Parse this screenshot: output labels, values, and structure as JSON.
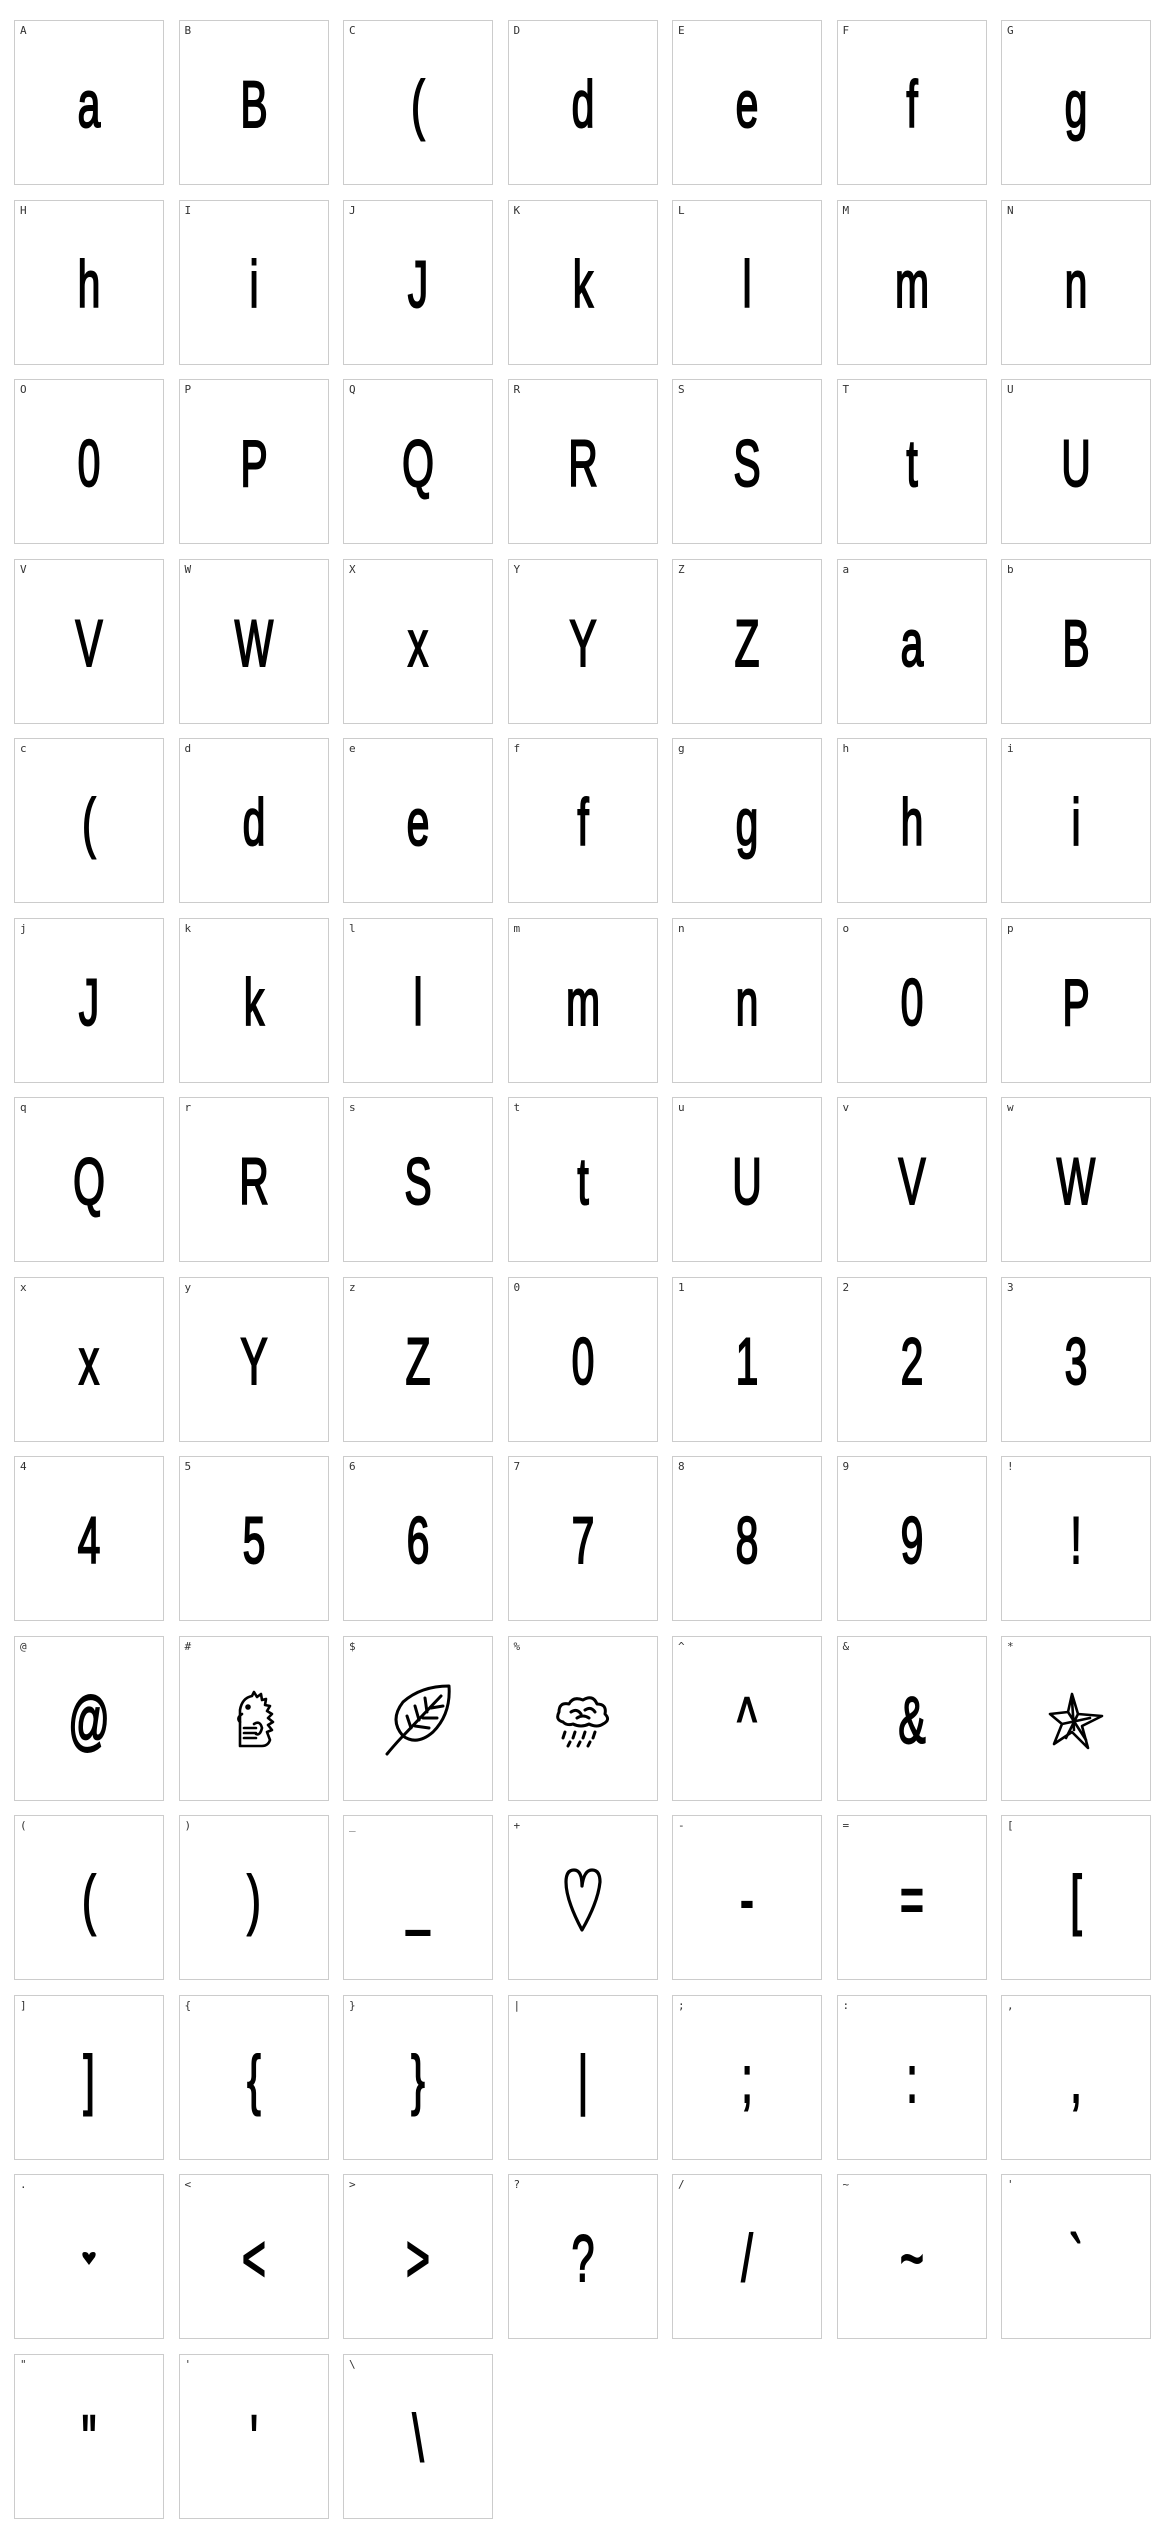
{
  "glyphs": [
    {
      "label": "A",
      "glyph": "a"
    },
    {
      "label": "B",
      "glyph": "B"
    },
    {
      "label": "C",
      "glyph": "("
    },
    {
      "label": "D",
      "glyph": "d"
    },
    {
      "label": "E",
      "glyph": "e"
    },
    {
      "label": "F",
      "glyph": "f"
    },
    {
      "label": "G",
      "glyph": "g"
    },
    {
      "label": "H",
      "glyph": "h"
    },
    {
      "label": "I",
      "glyph": "i"
    },
    {
      "label": "J",
      "glyph": "J"
    },
    {
      "label": "K",
      "glyph": "k"
    },
    {
      "label": "L",
      "glyph": "l"
    },
    {
      "label": "M",
      "glyph": "m"
    },
    {
      "label": "N",
      "glyph": "n"
    },
    {
      "label": "O",
      "glyph": "0"
    },
    {
      "label": "P",
      "glyph": "P"
    },
    {
      "label": "Q",
      "glyph": "Q"
    },
    {
      "label": "R",
      "glyph": "R"
    },
    {
      "label": "S",
      "glyph": "S"
    },
    {
      "label": "T",
      "glyph": "t"
    },
    {
      "label": "U",
      "glyph": "U"
    },
    {
      "label": "V",
      "glyph": "V"
    },
    {
      "label": "W",
      "glyph": "W"
    },
    {
      "label": "X",
      "glyph": "x"
    },
    {
      "label": "Y",
      "glyph": "Y"
    },
    {
      "label": "Z",
      "glyph": "Z"
    },
    {
      "label": "a",
      "glyph": "a"
    },
    {
      "label": "b",
      "glyph": "B"
    },
    {
      "label": "c",
      "glyph": "("
    },
    {
      "label": "d",
      "glyph": "d"
    },
    {
      "label": "e",
      "glyph": "e"
    },
    {
      "label": "f",
      "glyph": "f"
    },
    {
      "label": "g",
      "glyph": "g"
    },
    {
      "label": "h",
      "glyph": "h"
    },
    {
      "label": "i",
      "glyph": "i"
    },
    {
      "label": "j",
      "glyph": "J"
    },
    {
      "label": "k",
      "glyph": "k"
    },
    {
      "label": "l",
      "glyph": "l"
    },
    {
      "label": "m",
      "glyph": "m"
    },
    {
      "label": "n",
      "glyph": "n"
    },
    {
      "label": "o",
      "glyph": "0"
    },
    {
      "label": "p",
      "glyph": "P"
    },
    {
      "label": "q",
      "glyph": "Q"
    },
    {
      "label": "r",
      "glyph": "R"
    },
    {
      "label": "s",
      "glyph": "S"
    },
    {
      "label": "t",
      "glyph": "t"
    },
    {
      "label": "u",
      "glyph": "U"
    },
    {
      "label": "v",
      "glyph": "V"
    },
    {
      "label": "w",
      "glyph": "W"
    },
    {
      "label": "x",
      "glyph": "x"
    },
    {
      "label": "y",
      "glyph": "Y"
    },
    {
      "label": "z",
      "glyph": "Z"
    },
    {
      "label": "0",
      "glyph": "0"
    },
    {
      "label": "1",
      "glyph": "1"
    },
    {
      "label": "2",
      "glyph": "2"
    },
    {
      "label": "3",
      "glyph": "3"
    },
    {
      "label": "4",
      "glyph": "4"
    },
    {
      "label": "5",
      "glyph": "5"
    },
    {
      "label": "6",
      "glyph": "6"
    },
    {
      "label": "7",
      "glyph": "7"
    },
    {
      "label": "8",
      "glyph": "8"
    },
    {
      "label": "9",
      "glyph": "9"
    },
    {
      "label": "!",
      "glyph": "!"
    },
    {
      "label": "@",
      "glyph": "@"
    },
    {
      "label": "#",
      "glyph": "",
      "icon": "dinosaur-icon"
    },
    {
      "label": "$",
      "glyph": "",
      "icon": "leaf-icon"
    },
    {
      "label": "%",
      "glyph": "",
      "icon": "rain-cloud-icon"
    },
    {
      "label": "^",
      "glyph": "^"
    },
    {
      "label": "&",
      "glyph": "&"
    },
    {
      "label": "*",
      "glyph": "",
      "icon": "star-icon"
    },
    {
      "label": "(",
      "glyph": "("
    },
    {
      "label": ")",
      "glyph": ")"
    },
    {
      "label": "_",
      "glyph": "_"
    },
    {
      "label": "+",
      "glyph": "",
      "icon": "heart-icon"
    },
    {
      "label": "-",
      "glyph": "-"
    },
    {
      "label": "=",
      "glyph": "="
    },
    {
      "label": "[",
      "glyph": "["
    },
    {
      "label": "]",
      "glyph": "]"
    },
    {
      "label": "{",
      "glyph": "{"
    },
    {
      "label": "}",
      "glyph": "}"
    },
    {
      "label": "|",
      "glyph": "|"
    },
    {
      "label": ";",
      "glyph": ";"
    },
    {
      "label": ":",
      "glyph": ":"
    },
    {
      "label": ",",
      "glyph": ","
    },
    {
      "label": ".",
      "glyph": "",
      "icon": "small-heart-icon"
    },
    {
      "label": "<",
      "glyph": "<"
    },
    {
      "label": ">",
      "glyph": ">"
    },
    {
      "label": "?",
      "glyph": "?"
    },
    {
      "label": "/",
      "glyph": "/"
    },
    {
      "label": "~",
      "glyph": "~"
    },
    {
      "label": "'",
      "glyph": "`"
    },
    {
      "label": "\"",
      "glyph": "\""
    },
    {
      "label": "'",
      "glyph": "'"
    },
    {
      "label": "\\",
      "glyph": "\\"
    }
  ],
  "colors": {
    "background": "#ffffff",
    "cell_border": "#cccccc",
    "label": "#333333",
    "glyph": "#000000"
  }
}
